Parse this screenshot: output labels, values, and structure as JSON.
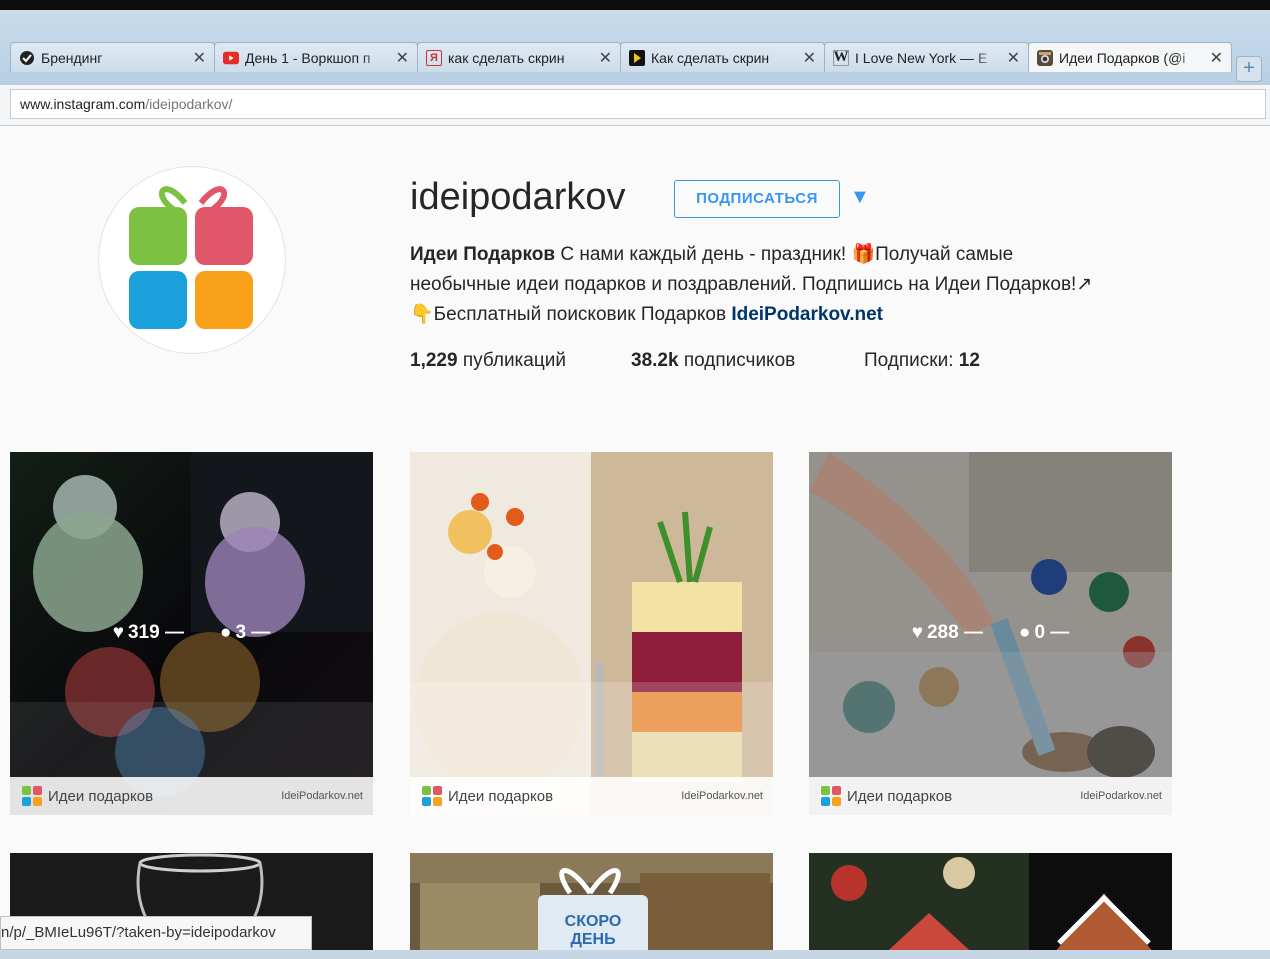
{
  "browser": {
    "tabs": [
      {
        "title": "Брендинг",
        "icon": "tab-branding-icon",
        "active": false
      },
      {
        "title": "День 1 - Воркшоп п",
        "icon": "youtube-icon",
        "active": false
      },
      {
        "title": "как сделать скрин",
        "icon": "yandex-icon",
        "active": false
      },
      {
        "title": "Как сделать скрин",
        "icon": "play-icon",
        "active": false
      },
      {
        "title": "I Love New York — E",
        "icon": "wikipedia-icon",
        "active": false
      },
      {
        "title": "Идеи Подарков (@i",
        "icon": "instagram-icon",
        "active": true
      }
    ],
    "url": "www.instagram.com/ideipodarkov/",
    "url_domain": "www.instagram.com",
    "url_path": "/ideipodarkov/",
    "status_link": "n/p/_BMIeLu96T/?taken-by=ideipodarkov"
  },
  "profile": {
    "username": "ideipodarkov",
    "follow_label": "ПОДПИСАТЬСЯ",
    "bio_name": "Идеи Подарков",
    "bio_line1": " С нами каждый день - праздник! 🎁Получай самые",
    "bio_line2": "необычные идеи подарков и поздравлений. Подпишись на Идеи Подарков!↗",
    "bio_line3": "👇Бесплатный поисковик Подарков ",
    "bio_link": "IdeiPodarkov.net",
    "posts_count": "1,229",
    "posts_label": " публикаций",
    "followers_count": "38.2k",
    "followers_label": " подписчиков",
    "following_label": "Подписки: ",
    "following_count": "12"
  },
  "posts": [
    {
      "likes": "319 —",
      "comments": "3 —",
      "brand": "Идеи подарков",
      "site": "IdeiPodarkov.net"
    },
    {
      "brand": "Идеи подарков",
      "site": "IdeiPodarkov.net"
    },
    {
      "likes": "288 —",
      "comments": "0 —",
      "brand": "Идеи подарков",
      "site": "IdeiPodarkov.net"
    }
  ],
  "teaser_text": "СКОРО ДЕНЬ",
  "colors": {
    "accent": "#3897f0",
    "logo_green": "#7cc142",
    "logo_red": "#e2566a",
    "logo_blue": "#1ba1dc",
    "logo_orange": "#f9a11b"
  }
}
